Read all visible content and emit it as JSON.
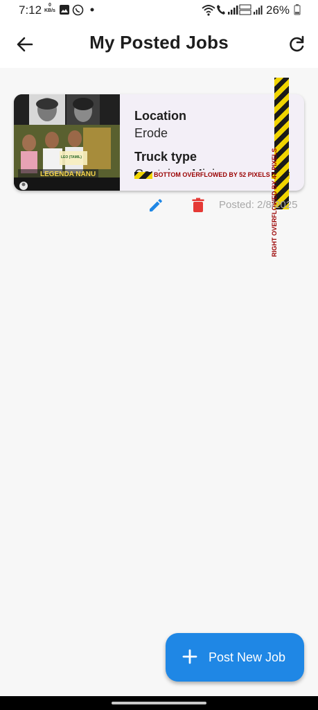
{
  "status_bar": {
    "time": "7:12",
    "net_speed_value": "0",
    "net_speed_unit": "KB/s",
    "battery": "26%",
    "icons": [
      "gallery-icon",
      "whatsapp-icon",
      "wifi-icon",
      "call-icon",
      "signal-icon",
      "volte-icon",
      "battery-icon"
    ]
  },
  "app_bar": {
    "title": "My Posted Jobs",
    "back_icon": "arrow-back-icon",
    "refresh_icon": "refresh-icon"
  },
  "jobs": [
    {
      "thumbnail": {
        "caption": "LEGENDA NANU",
        "badge": "LEO (TAMIL)"
      },
      "location_label": "Location",
      "location_value": "Erode",
      "truck_type_label": "Truck type",
      "truck_type_value": "Container Mini",
      "bottom_overflow_msg": "BOTTOM OVERFLOWED BY 52 PIXELS",
      "right_overflow_msg": "RIGHT OVERFLOWED BY 47 PIXELS",
      "posted_text": "Posted: 2/8/2025",
      "edit_icon": "pencil-icon",
      "delete_icon": "trash-icon"
    }
  ],
  "fab": {
    "label": "Post New Job",
    "icon": "plus-icon"
  },
  "colors": {
    "accent": "#1f87e5",
    "delete": "#e53935",
    "card_bg": "#f3eff7",
    "overflow_text": "#9a0000"
  }
}
